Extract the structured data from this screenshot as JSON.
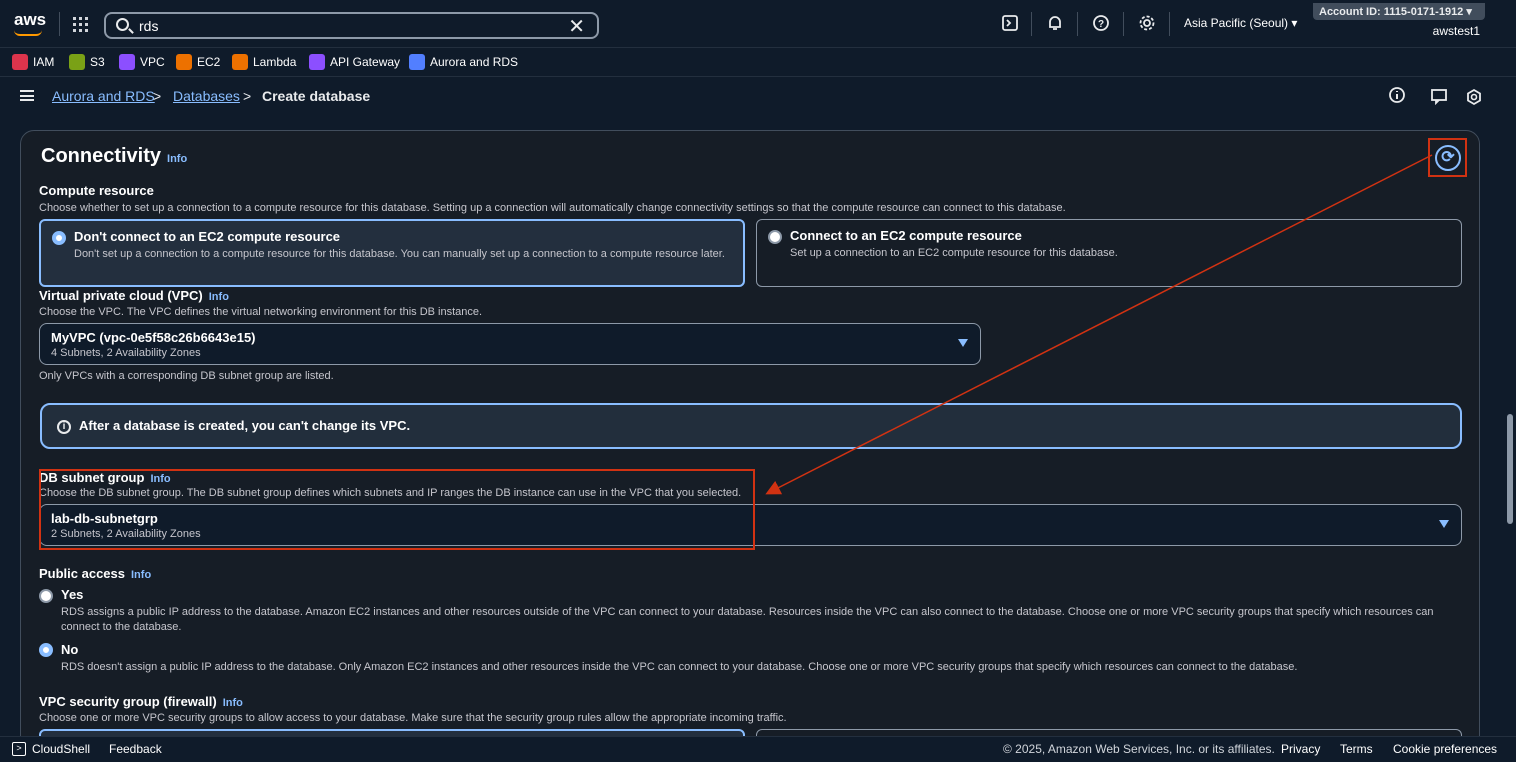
{
  "topbar": {
    "logo": "aws",
    "search_value": "rds",
    "region": "Asia Pacific (Seoul) ▾",
    "account": "Account ID: 1115-0171-1912 ▾",
    "username": "awstest1"
  },
  "favorites": [
    {
      "label": "IAM",
      "color": "#dd344c"
    },
    {
      "label": "S3",
      "color": "#7aa116"
    },
    {
      "label": "VPC",
      "color": "#8c4fff"
    },
    {
      "label": "EC2",
      "color": "#ed7100"
    },
    {
      "label": "Lambda",
      "color": "#ed7100"
    },
    {
      "label": "API Gateway",
      "color": "#8c4fff"
    },
    {
      "label": "Aurora and RDS",
      "color": "#527fff"
    }
  ],
  "breadcrumb": {
    "items": [
      "Aurora and RDS",
      "Databases",
      "Create database"
    ],
    "sep": ">"
  },
  "connectivity": {
    "title": "Connectivity",
    "info": "Info",
    "compute": {
      "label": "Compute resource",
      "desc": "Choose whether to set up a connection to a compute resource for this database. Setting up a connection will automatically change connectivity settings so that the compute resource can connect to this database.",
      "options": [
        {
          "title": "Don't connect to an EC2 compute resource",
          "desc": "Don't set up a connection to a compute resource for this database. You can manually set up a connection to a compute resource later.",
          "selected": true
        },
        {
          "title": "Connect to an EC2 compute resource",
          "desc": "Set up a connection to an EC2 compute resource for this database.",
          "selected": false
        }
      ]
    },
    "vpc": {
      "label": "Virtual private cloud (VPC)",
      "info": "Info",
      "desc": "Choose the VPC. The VPC defines the virtual networking environment for this DB instance.",
      "value": "MyVPC (vpc-0e5f58c26b6643e15)",
      "sub": "4 Subnets, 2 Availability Zones",
      "hint": "Only VPCs with a corresponding DB subnet group are listed."
    },
    "alert": "After a database is created, you can't change its VPC.",
    "subnet": {
      "label": "DB subnet group",
      "info": "Info",
      "desc": "Choose the DB subnet group. The DB subnet group defines which subnets and IP ranges the DB instance can use in the VPC that you selected.",
      "value": "lab-db-subnetgrp",
      "sub": "2 Subnets, 2 Availability Zones"
    },
    "public": {
      "label": "Public access",
      "info": "Info",
      "options": [
        {
          "title": "Yes",
          "desc": "RDS assigns a public IP address to the database. Amazon EC2 instances and other resources outside of the VPC can connect to your database. Resources inside the VPC can also connect to the database. Choose one or more VPC security groups that specify which resources can connect to the database.",
          "selected": false
        },
        {
          "title": "No",
          "desc": "RDS doesn't assign a public IP address to the database. Only Amazon EC2 instances and other resources inside the VPC can connect to your database. Choose one or more VPC security groups that specify which resources can connect to the database.",
          "selected": true
        }
      ]
    },
    "sg": {
      "label": "VPC security group (firewall)",
      "info": "Info",
      "desc": "Choose one or more VPC security groups to allow access to your database. Make sure that the security group rules allow the appropriate incoming traffic."
    }
  },
  "footer": {
    "cloudshell": "CloudShell",
    "feedback": "Feedback",
    "copyright": "© 2025, Amazon Web Services, Inc. or its affiliates.",
    "privacy": "Privacy",
    "terms": "Terms",
    "cookies": "Cookie preferences"
  }
}
